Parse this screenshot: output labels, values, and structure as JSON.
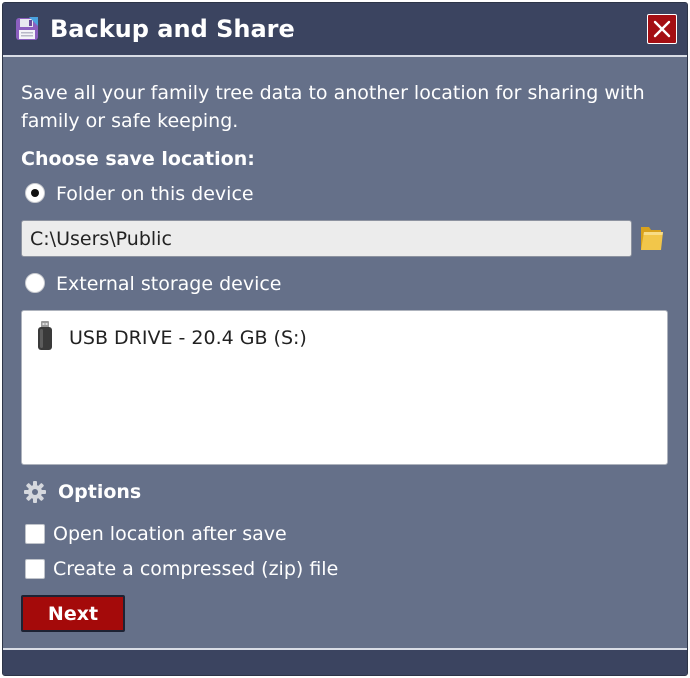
{
  "window": {
    "title": "Backup and Share",
    "close_label": "Close"
  },
  "description": "Save all your family tree data to another location for sharing with family or safe keeping.",
  "save_location": {
    "label": "Choose save location:",
    "options": [
      {
        "label": "Folder on this device",
        "selected": true
      },
      {
        "label": "External storage device",
        "selected": false
      }
    ],
    "folder_path": "C:\\Users\\Public",
    "devices": [
      {
        "label": "USB DRIVE - 20.4 GB (S:)",
        "icon": "usb-drive-icon"
      }
    ]
  },
  "options": {
    "label": "Options",
    "checkboxes": [
      {
        "label": "Open location after save",
        "checked": false
      },
      {
        "label": "Create a compressed (zip) file",
        "checked": false
      }
    ]
  },
  "actions": {
    "next_label": "Next"
  },
  "colors": {
    "background": "#657089",
    "titlebar": "#3b4460",
    "accent_red": "#a40a0a"
  }
}
